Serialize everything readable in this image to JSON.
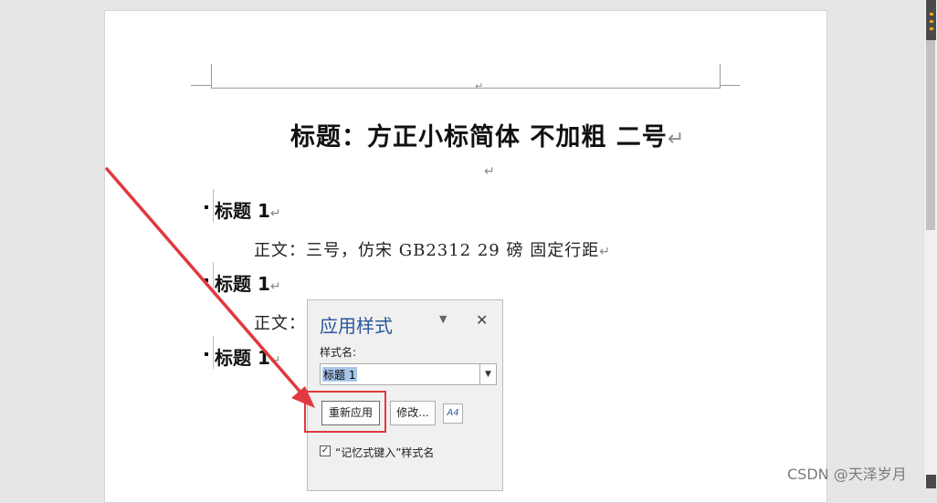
{
  "document": {
    "header_mark": "↵",
    "title": "标题：方正小标简体 不加粗  二号",
    "para_mark": "↵",
    "empty_para_mark": "↵",
    "headings": [
      "标题 1",
      "标题 1",
      "标题 1"
    ],
    "body_lines": [
      "正文：三号，仿宋 GB2312 29 磅 固定行距",
      "正文："
    ]
  },
  "dialog": {
    "title": "应用样式",
    "menu_icon": "chevron-down-icon",
    "close_label": "✕",
    "style_name_label": "样式名:",
    "style_name_value": "标题 1",
    "reapply_label": "重新应用",
    "modify_label": "修改...",
    "styles_button_label": "A4",
    "checkbox_checked": true,
    "checkbox_mark": "✓",
    "checkbox_label": "“记忆式键入”样式名"
  },
  "annotation": {
    "arrow_color": "#e0393e",
    "box_color": "#e0393e"
  },
  "watermark": "CSDN @天泽岁月"
}
